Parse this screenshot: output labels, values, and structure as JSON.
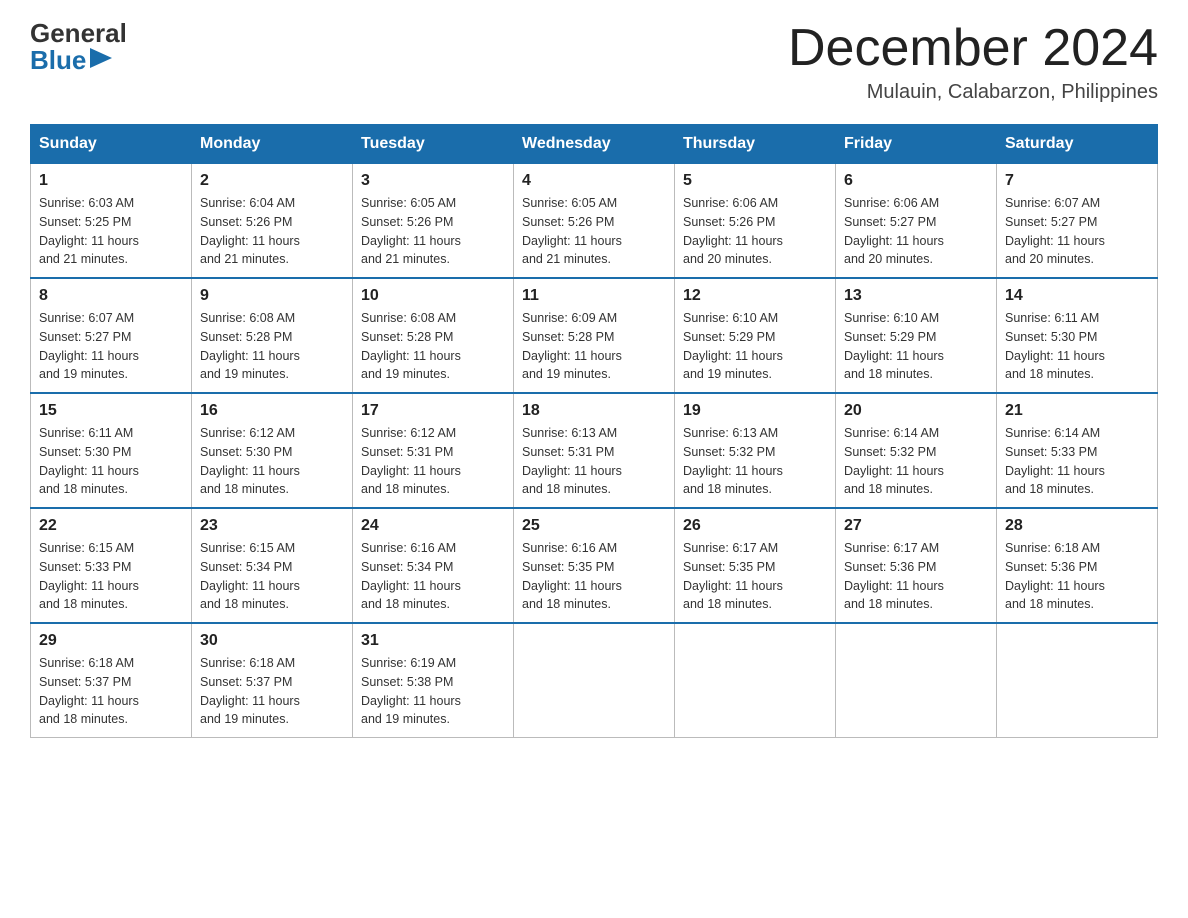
{
  "header": {
    "logo_general": "General",
    "logo_blue": "Blue",
    "month_title": "December 2024",
    "location": "Mulauin, Calabarzon, Philippines"
  },
  "days_of_week": [
    "Sunday",
    "Monday",
    "Tuesday",
    "Wednesday",
    "Thursday",
    "Friday",
    "Saturday"
  ],
  "weeks": [
    [
      {
        "day": "1",
        "sunrise": "6:03 AM",
        "sunset": "5:25 PM",
        "daylight": "11 hours and 21 minutes."
      },
      {
        "day": "2",
        "sunrise": "6:04 AM",
        "sunset": "5:26 PM",
        "daylight": "11 hours and 21 minutes."
      },
      {
        "day": "3",
        "sunrise": "6:05 AM",
        "sunset": "5:26 PM",
        "daylight": "11 hours and 21 minutes."
      },
      {
        "day": "4",
        "sunrise": "6:05 AM",
        "sunset": "5:26 PM",
        "daylight": "11 hours and 21 minutes."
      },
      {
        "day": "5",
        "sunrise": "6:06 AM",
        "sunset": "5:26 PM",
        "daylight": "11 hours and 20 minutes."
      },
      {
        "day": "6",
        "sunrise": "6:06 AM",
        "sunset": "5:27 PM",
        "daylight": "11 hours and 20 minutes."
      },
      {
        "day": "7",
        "sunrise": "6:07 AM",
        "sunset": "5:27 PM",
        "daylight": "11 hours and 20 minutes."
      }
    ],
    [
      {
        "day": "8",
        "sunrise": "6:07 AM",
        "sunset": "5:27 PM",
        "daylight": "11 hours and 19 minutes."
      },
      {
        "day": "9",
        "sunrise": "6:08 AM",
        "sunset": "5:28 PM",
        "daylight": "11 hours and 19 minutes."
      },
      {
        "day": "10",
        "sunrise": "6:08 AM",
        "sunset": "5:28 PM",
        "daylight": "11 hours and 19 minutes."
      },
      {
        "day": "11",
        "sunrise": "6:09 AM",
        "sunset": "5:28 PM",
        "daylight": "11 hours and 19 minutes."
      },
      {
        "day": "12",
        "sunrise": "6:10 AM",
        "sunset": "5:29 PM",
        "daylight": "11 hours and 19 minutes."
      },
      {
        "day": "13",
        "sunrise": "6:10 AM",
        "sunset": "5:29 PM",
        "daylight": "11 hours and 18 minutes."
      },
      {
        "day": "14",
        "sunrise": "6:11 AM",
        "sunset": "5:30 PM",
        "daylight": "11 hours and 18 minutes."
      }
    ],
    [
      {
        "day": "15",
        "sunrise": "6:11 AM",
        "sunset": "5:30 PM",
        "daylight": "11 hours and 18 minutes."
      },
      {
        "day": "16",
        "sunrise": "6:12 AM",
        "sunset": "5:30 PM",
        "daylight": "11 hours and 18 minutes."
      },
      {
        "day": "17",
        "sunrise": "6:12 AM",
        "sunset": "5:31 PM",
        "daylight": "11 hours and 18 minutes."
      },
      {
        "day": "18",
        "sunrise": "6:13 AM",
        "sunset": "5:31 PM",
        "daylight": "11 hours and 18 minutes."
      },
      {
        "day": "19",
        "sunrise": "6:13 AM",
        "sunset": "5:32 PM",
        "daylight": "11 hours and 18 minutes."
      },
      {
        "day": "20",
        "sunrise": "6:14 AM",
        "sunset": "5:32 PM",
        "daylight": "11 hours and 18 minutes."
      },
      {
        "day": "21",
        "sunrise": "6:14 AM",
        "sunset": "5:33 PM",
        "daylight": "11 hours and 18 minutes."
      }
    ],
    [
      {
        "day": "22",
        "sunrise": "6:15 AM",
        "sunset": "5:33 PM",
        "daylight": "11 hours and 18 minutes."
      },
      {
        "day": "23",
        "sunrise": "6:15 AM",
        "sunset": "5:34 PM",
        "daylight": "11 hours and 18 minutes."
      },
      {
        "day": "24",
        "sunrise": "6:16 AM",
        "sunset": "5:34 PM",
        "daylight": "11 hours and 18 minutes."
      },
      {
        "day": "25",
        "sunrise": "6:16 AM",
        "sunset": "5:35 PM",
        "daylight": "11 hours and 18 minutes."
      },
      {
        "day": "26",
        "sunrise": "6:17 AM",
        "sunset": "5:35 PM",
        "daylight": "11 hours and 18 minutes."
      },
      {
        "day": "27",
        "sunrise": "6:17 AM",
        "sunset": "5:36 PM",
        "daylight": "11 hours and 18 minutes."
      },
      {
        "day": "28",
        "sunrise": "6:18 AM",
        "sunset": "5:36 PM",
        "daylight": "11 hours and 18 minutes."
      }
    ],
    [
      {
        "day": "29",
        "sunrise": "6:18 AM",
        "sunset": "5:37 PM",
        "daylight": "11 hours and 18 minutes."
      },
      {
        "day": "30",
        "sunrise": "6:18 AM",
        "sunset": "5:37 PM",
        "daylight": "11 hours and 19 minutes."
      },
      {
        "day": "31",
        "sunrise": "6:19 AM",
        "sunset": "5:38 PM",
        "daylight": "11 hours and 19 minutes."
      },
      null,
      null,
      null,
      null
    ]
  ],
  "labels": {
    "sunrise": "Sunrise:",
    "sunset": "Sunset:",
    "daylight": "Daylight:"
  }
}
